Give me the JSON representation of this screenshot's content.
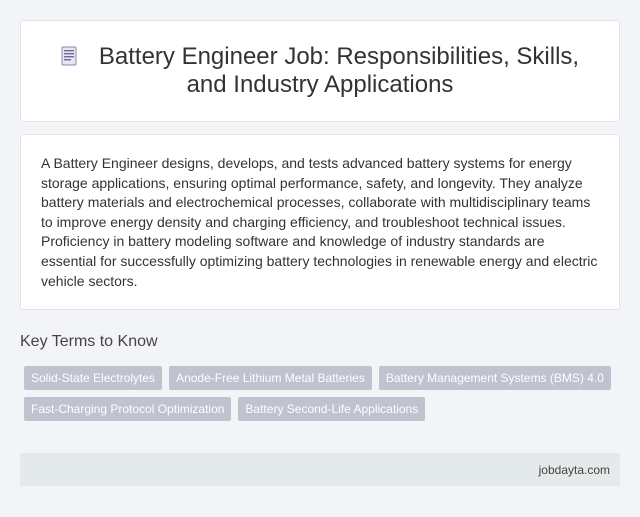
{
  "header": {
    "icon": "document-icon",
    "title": "Battery Engineer Job: Responsibilities, Skills, and Industry Applications"
  },
  "summary": {
    "text": "A Battery Engineer designs, develops, and tests advanced battery systems for energy storage applications, ensuring optimal performance, safety, and longevity. They analyze battery materials and electrochemical processes, collaborate with multidisciplinary teams to improve energy density and charging efficiency, and troubleshoot technical issues. Proficiency in battery modeling software and knowledge of industry standards are essential for successfully optimizing battery technologies in renewable energy and electric vehicle sectors."
  },
  "key_terms": {
    "heading": "Key Terms to Know",
    "tags": [
      "Solid-State Electrolytes",
      "Anode-Free Lithium Metal Batteries",
      "Battery Management Systems (BMS) 4.0",
      "Fast-Charging Protocol Optimization",
      "Battery Second-Life Applications"
    ]
  },
  "footer": {
    "site": "jobdayta.com"
  }
}
